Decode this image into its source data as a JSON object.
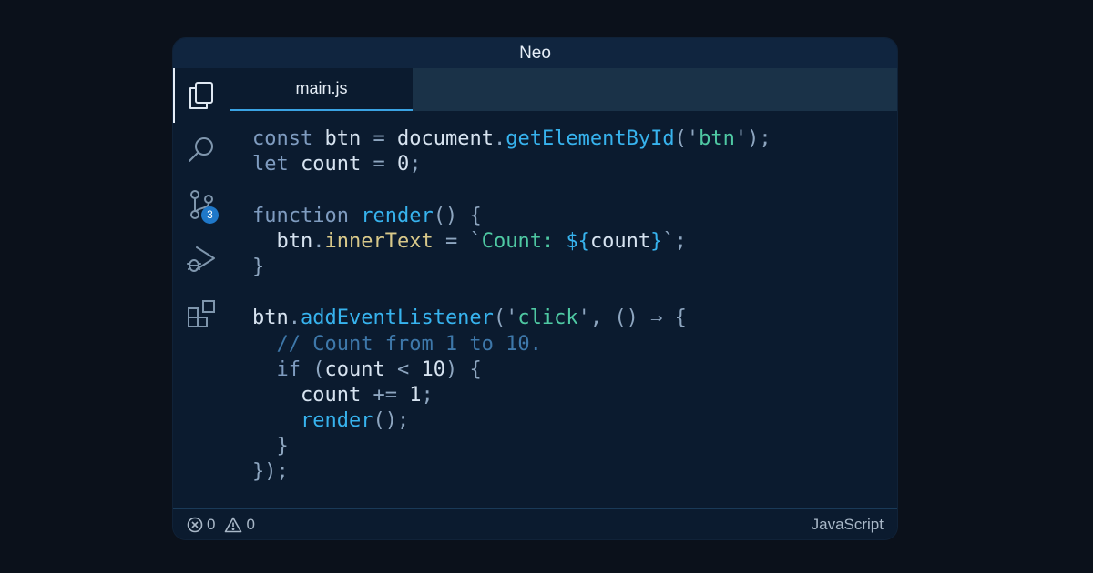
{
  "window": {
    "title": "Neo"
  },
  "activity_bar": {
    "items": [
      {
        "icon": "files-icon",
        "active": true
      },
      {
        "icon": "search-icon"
      },
      {
        "icon": "source-control-icon",
        "badge": "3"
      },
      {
        "icon": "run-debug-icon"
      },
      {
        "icon": "extensions-icon"
      }
    ]
  },
  "tabs": [
    {
      "label": "main.js",
      "active": true
    }
  ],
  "code": {
    "language": "javascript",
    "lines": [
      "const btn = document.getElementById('btn');",
      "let count = 0;",
      "",
      "function render() {",
      "  btn.innerText = `Count: ${count}`;",
      "}",
      "",
      "btn.addEventListener('click', () ⇒ {",
      "  // Count from 1 to 10.",
      "  if (count < 10) {",
      "    count += 1;",
      "    render();",
      "  }",
      "});"
    ]
  },
  "status_bar": {
    "errors": "0",
    "warnings": "0",
    "language": "JavaScript"
  },
  "colors": {
    "background": "#0b111b",
    "window": "#0b1b2f",
    "accent": "#3aa3e3",
    "badge": "#1f78c9"
  }
}
